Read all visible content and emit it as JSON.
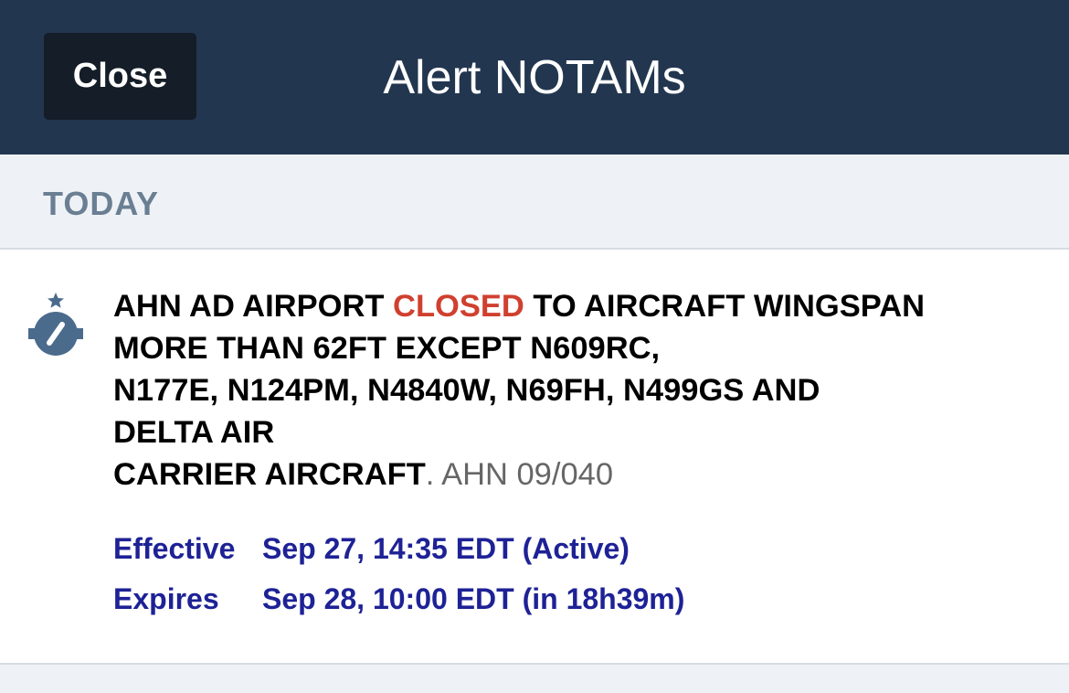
{
  "header": {
    "close_label": "Close",
    "title": "Alert NOTAMs",
    "background": "#22364f"
  },
  "section": {
    "label": "TODAY"
  },
  "notam": {
    "icon": "airport-closed-icon",
    "text_part1": "AHN AD AIRPORT ",
    "text_closed": "CLOSED",
    "text_part2": " TO AIRCRAFT WINGSPAN",
    "line2": "MORE THAN 62FT EXCEPT N609RC,",
    "line3": "N177E, N124PM, N4840W, N69FH, N499GS AND",
    "line4": "DELTA AIR",
    "line5": "CARRIER AIRCRAFT",
    "period": ".",
    "notam_id": " AHN 09/040",
    "closed_color": "#d0402f",
    "effective_label": "Effective",
    "effective_value": "Sep 27, 14:35 EDT (Active)",
    "expires_label": "Expires",
    "expires_value": "Sep 28, 10:00 EDT (in 18h39m)",
    "time_color": "#1e2296"
  }
}
